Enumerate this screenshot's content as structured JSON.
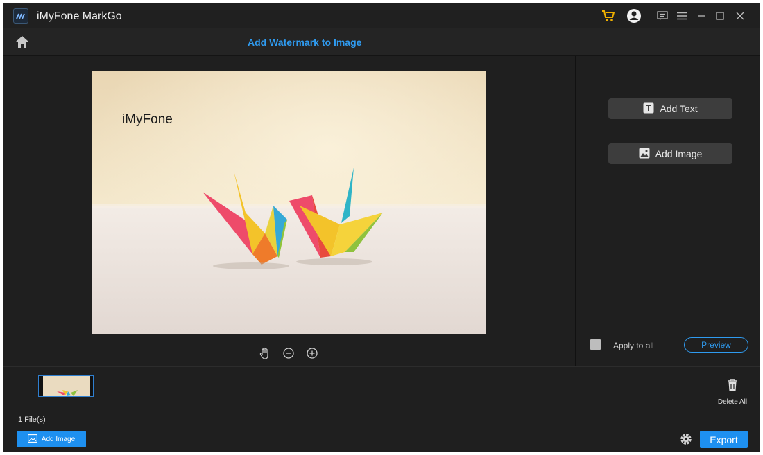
{
  "app": {
    "title": "iMyFone MarkGo"
  },
  "titlebar": {
    "icons": [
      "cart-icon",
      "account-icon",
      "feedback-icon",
      "menu-icon",
      "minimize-icon",
      "maximize-icon",
      "close-icon"
    ]
  },
  "header": {
    "title": "Add Watermark to Image"
  },
  "canvas": {
    "watermark_text": "iMyFone"
  },
  "panel": {
    "add_text_label": "Add Text",
    "add_image_label": "Add Image",
    "apply_all_label": "Apply to all",
    "preview_label": "Preview"
  },
  "strip": {
    "file_count": "1 File(s)",
    "delete_all_label": "Delete All"
  },
  "bottom": {
    "add_image_label": "Add Image",
    "export_label": "Export"
  },
  "colors": {
    "accent": "#1e90f0",
    "title_blue": "#2f9bf0",
    "cart": "#f0b000",
    "background": "#1f1f1f"
  }
}
